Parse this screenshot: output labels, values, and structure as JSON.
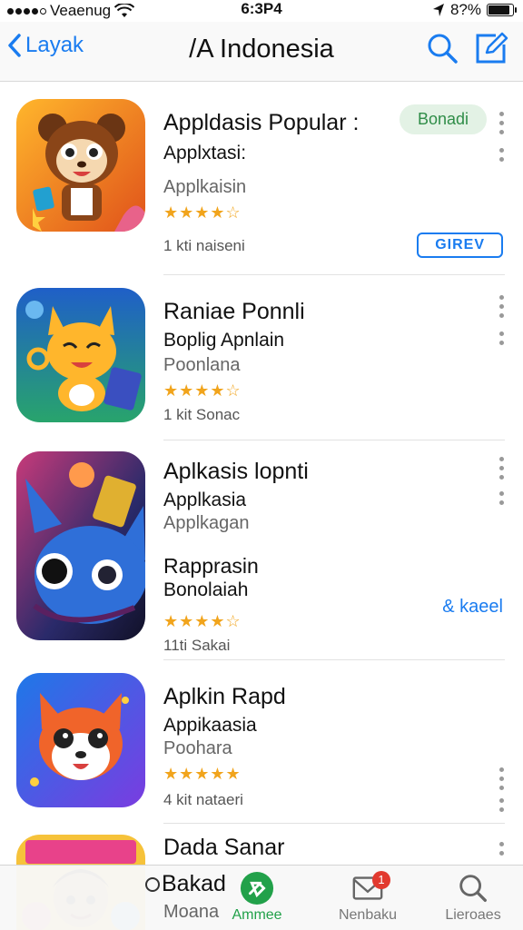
{
  "status": {
    "carrier": "Veaenug",
    "time": "6:3P4",
    "battery": "8?%"
  },
  "nav": {
    "back_label": "Layak",
    "title": "/A Indonesia"
  },
  "apps": [
    {
      "title": "Appldasis Popular :",
      "subtitle": "Applxtasi:",
      "category": "Applkaisin",
      "rating": "★★★★☆",
      "count": "1 kti naiseni",
      "badge": "Bonadi",
      "button": "GIREV"
    },
    {
      "title": "Raniae Ponnli",
      "subtitle": "Boplig Apnlain",
      "category": "Poonlana",
      "rating": "★★★★☆",
      "count": "1 kit Sonac"
    },
    {
      "title": "Aplkasis lopnti",
      "subtitle": "Applkasia",
      "category": "Applkagan",
      "extra1": "Rapprasin",
      "extra2": "Bonolaiah",
      "rating": "★★★★☆",
      "count": "11ti Sakai",
      "link": "& kaeel"
    },
    {
      "title": "Aplkin Rapd",
      "subtitle": "Appikaasia",
      "category": "Poohara",
      "rating": "★★★★★",
      "count": "4 kit nataeri"
    },
    {
      "title": "Dada Sanar",
      "subtitle": "Bakad",
      "category": "Moana"
    }
  ],
  "tabs": [
    {
      "label": "Ammee"
    },
    {
      "label": "Nenbaku",
      "notif": "1"
    },
    {
      "label": "Lieroaes"
    }
  ],
  "colors": {
    "accent": "#1a7cf0",
    "active_tab": "#22a14a",
    "stars": "#f1a41c"
  }
}
